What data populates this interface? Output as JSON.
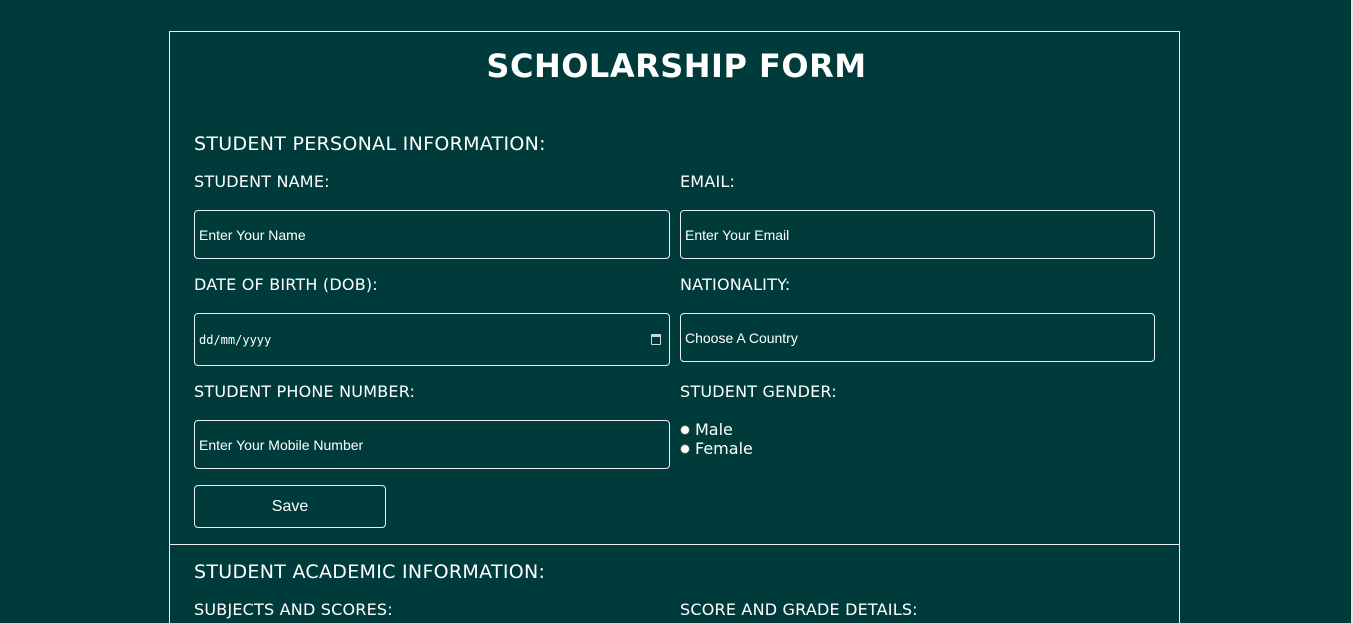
{
  "form": {
    "title": "SCHOLARSHIP FORM",
    "personal_section": {
      "heading": "STUDENT PERSONAL INFORMATION:",
      "name_label": "STUDENT NAME:",
      "name_placeholder": "Enter Your Name",
      "email_label": "EMAIL:",
      "email_placeholder": "Enter Your Email",
      "dob_label": "DATE OF BIRTH (DOB):",
      "dob_placeholder": "dd/mm/yyyy",
      "nationality_label": "NATIONALITY:",
      "nationality_value": "Choose A Country",
      "phone_label": "STUDENT PHONE NUMBER:",
      "phone_placeholder": "Enter Your Mobile Number",
      "gender_label": "STUDENT GENDER:",
      "gender_options": [
        "Male",
        "Female"
      ],
      "save_label": "Save"
    },
    "academic_section": {
      "heading": "STUDENT ACADEMIC INFORMATION:",
      "subjects_label": "SUBJECTS AND SCORES:",
      "grade_label": "SCORE AND GRADE DETAILS:"
    }
  },
  "colors": {
    "background": "#003b3b",
    "border": "#e9eef0",
    "text": "#ffffff"
  }
}
